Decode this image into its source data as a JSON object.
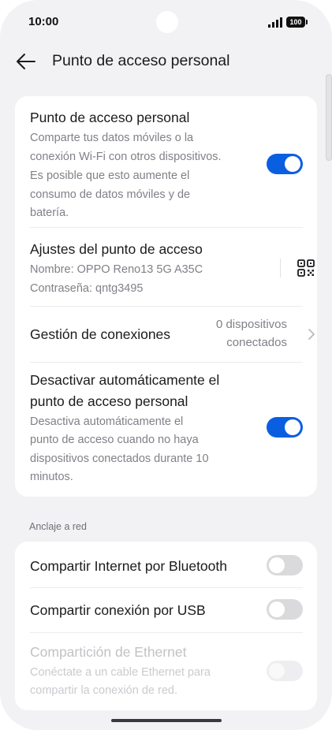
{
  "status_bar": {
    "time": "10:00",
    "battery": "100",
    "signal_icon": "signal-bars-icon"
  },
  "header": {
    "title": "Punto de acceso personal",
    "back_icon": "arrow-left-icon"
  },
  "hotspot_card": {
    "hotspot": {
      "title": "Punto de acceso personal",
      "desc_lines": [
        "Comparte tus datos móviles o la",
        "conexión Wi-Fi con otros dispositivos.",
        "Es posible que esto aumente el",
        "consumo de datos móviles y de",
        "batería."
      ],
      "toggle_on": true
    },
    "settings": {
      "title": "Ajustes del punto de acceso",
      "name_line": "Nombre: OPPO Reno13 5G A35C",
      "password_line": "Contraseña: qntg3495",
      "qr_icon": "qr-code-icon"
    },
    "connections": {
      "title": "Gestión de conexiones",
      "value_lines": [
        "0 dispositivos",
        "conectados"
      ],
      "chevron_icon": "chevron-right-icon"
    },
    "auto_off": {
      "title_lines": [
        "Desactivar automáticamente el",
        "punto de acceso personal"
      ],
      "desc_lines": [
        "Desactiva automáticamente el",
        "punto de acceso cuando no haya",
        "dispositivos conectados durante 10",
        "minutos."
      ],
      "toggle_on": true
    }
  },
  "tethering": {
    "section_label": "Anclaje a red",
    "bluetooth": {
      "title": "Compartir Internet por Bluetooth",
      "toggle_on": false
    },
    "usb": {
      "title": "Compartir conexión por USB",
      "toggle_on": false
    },
    "ethernet": {
      "title": "Compartición de Ethernet",
      "desc_lines": [
        "Conéctate a un cable Ethernet para",
        "compartir la conexión de red."
      ],
      "toggle_on": false,
      "disabled": true
    }
  },
  "colors": {
    "accent": "#0a5fe0",
    "background": "#f2f2f4",
    "card": "#ffffff",
    "secondary_text": "#808088"
  }
}
